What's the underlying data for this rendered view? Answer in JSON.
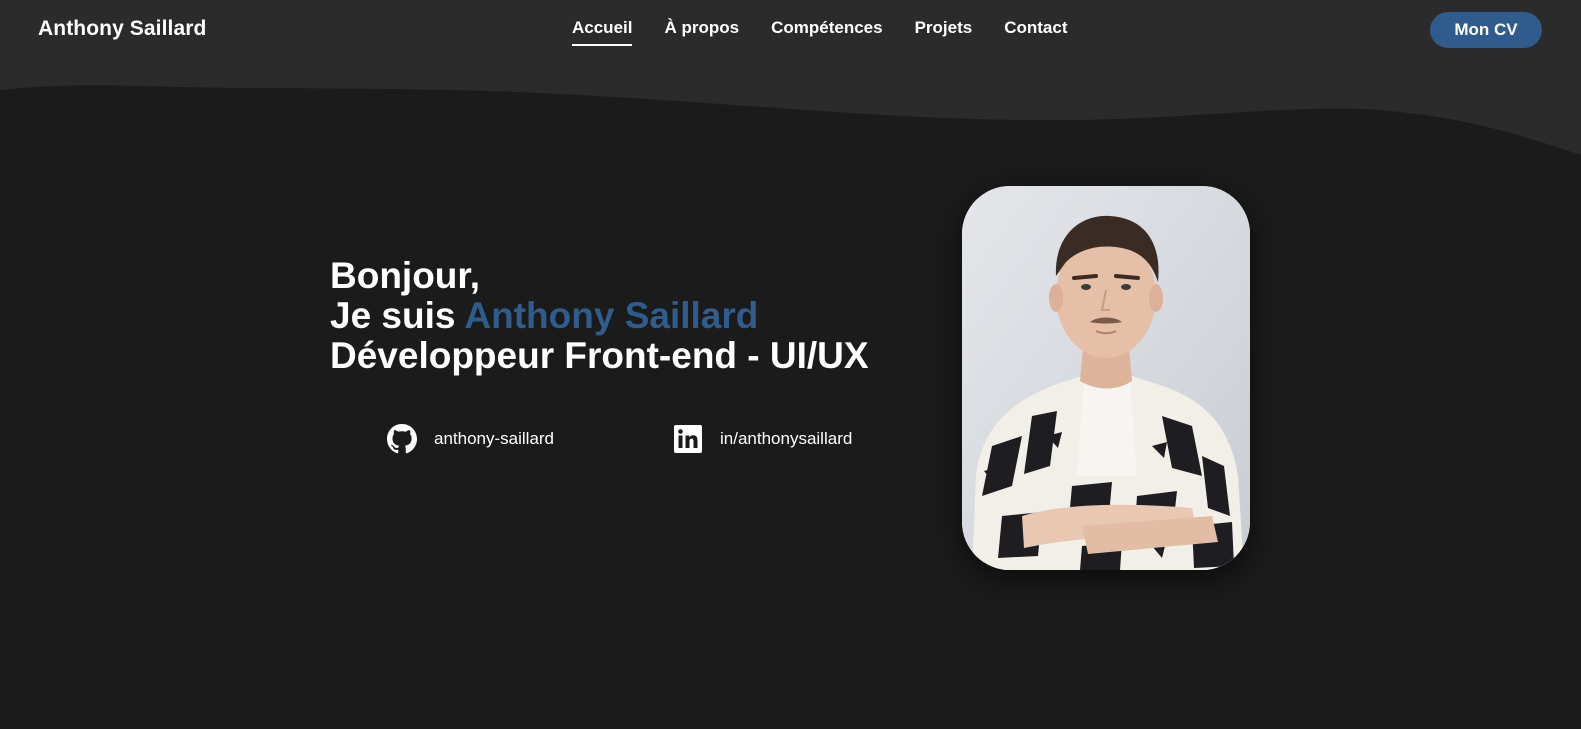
{
  "header": {
    "brand": "Anthony Saillard",
    "nav": [
      {
        "label": "Accueil",
        "active": true
      },
      {
        "label": "À propos",
        "active": false
      },
      {
        "label": "Compétences",
        "active": false
      },
      {
        "label": "Projets",
        "active": false
      },
      {
        "label": "Contact",
        "active": false
      }
    ],
    "cv_button": "Mon CV"
  },
  "hero": {
    "greeting": "Bonjour,",
    "intro_prefix": "Je suis ",
    "name": "Anthony Saillard",
    "role": "Développeur Front-end - UI/UX"
  },
  "socials": [
    {
      "icon": "github-icon",
      "label": "anthony-saillard"
    },
    {
      "icon": "linkedin-icon",
      "label": "in/anthonysaillard"
    }
  ],
  "colors": {
    "background": "#1b1b1b",
    "header_background": "#2b2b2b",
    "accent": "#2f5c8c",
    "text": "#ffffff"
  }
}
